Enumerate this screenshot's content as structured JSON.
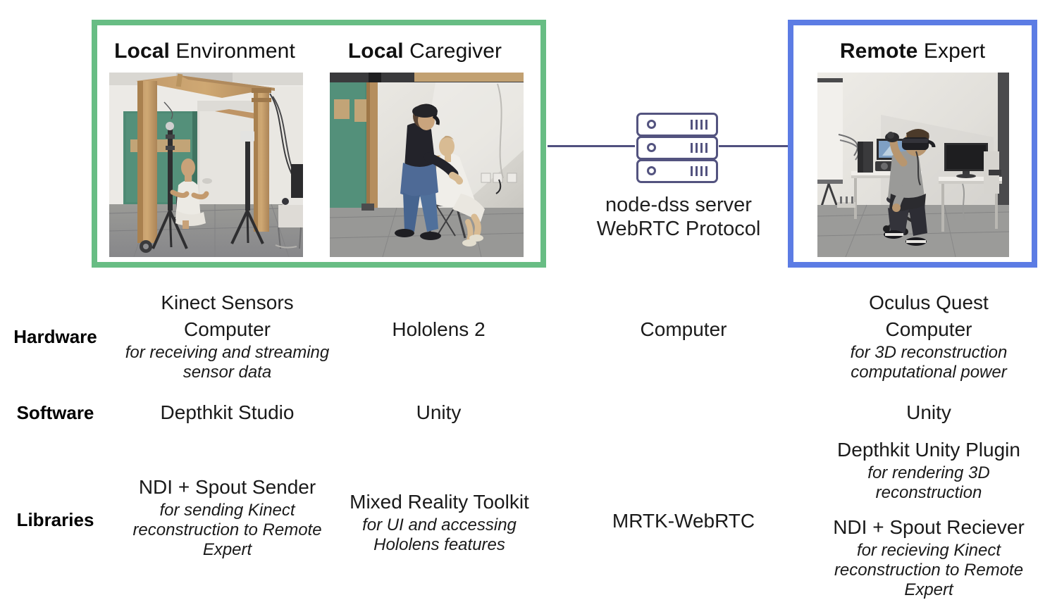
{
  "panels": {
    "local": {
      "border_color": "#68bd84",
      "titles": [
        {
          "bold": "Local",
          "rest": " Environment"
        },
        {
          "bold": "Local",
          "rest": " Caregiver"
        }
      ],
      "photos": [
        {
          "name": "local-environment-photo",
          "alt": "Lab room with wooden gantry frame, mannequin seated in white gown, two tripod camera stands, green door"
        },
        {
          "name": "local-caregiver-photo",
          "alt": "Caregiver wearing HoloLens assisting a seated mannequin on a chair"
        }
      ]
    },
    "remote": {
      "border_color": "#5c7ce4",
      "title": {
        "bold": "Remote",
        "rest": " Expert"
      },
      "photo": {
        "name": "remote-expert-photo",
        "alt": "Person wearing VR headset seated at a desk with monitors and projector screen"
      }
    }
  },
  "server": {
    "icon": "server-rack-icon",
    "line1": "node-dss server",
    "line2": "WebRTC Protocol",
    "stroke_color": "#53537f",
    "connector_color": "#50507f"
  },
  "rows": [
    {
      "label": "Hardware"
    },
    {
      "label": "Software"
    },
    {
      "label": "Libraries"
    }
  ],
  "hardware": {
    "local_environment": {
      "line1": "Kinect Sensors",
      "line2": "Computer",
      "note": "for receiving and streaming sensor data"
    },
    "local_caregiver": {
      "line1": "Hololens 2"
    },
    "server": {
      "line1": "Computer"
    },
    "remote_expert": {
      "line1": "Oculus Quest",
      "line2": "Computer",
      "note": "for 3D reconstruction computational power"
    }
  },
  "software": {
    "local_environment": {
      "line1": "Depthkit Studio"
    },
    "local_caregiver": {
      "line1": "Unity"
    },
    "server": {
      "line1": ""
    },
    "remote_expert": {
      "line1": "Unity"
    }
  },
  "libraries": {
    "local_environment": {
      "line1": "NDI + Spout Sender",
      "note": "for sending Kinect reconstruction to Remote Expert"
    },
    "local_caregiver": {
      "line1": "Mixed Reality Toolkit",
      "note": "for UI and accessing Hololens features"
    },
    "server": {
      "line1": "MRTK-WebRTC"
    },
    "remote_expert": {
      "line1": "Depthkit Unity Plugin",
      "note1": "for rendering 3D reconstruction",
      "line2": "NDI + Spout Reciever",
      "note2": "for recieving Kinect reconstruction to Remote Expert"
    }
  }
}
